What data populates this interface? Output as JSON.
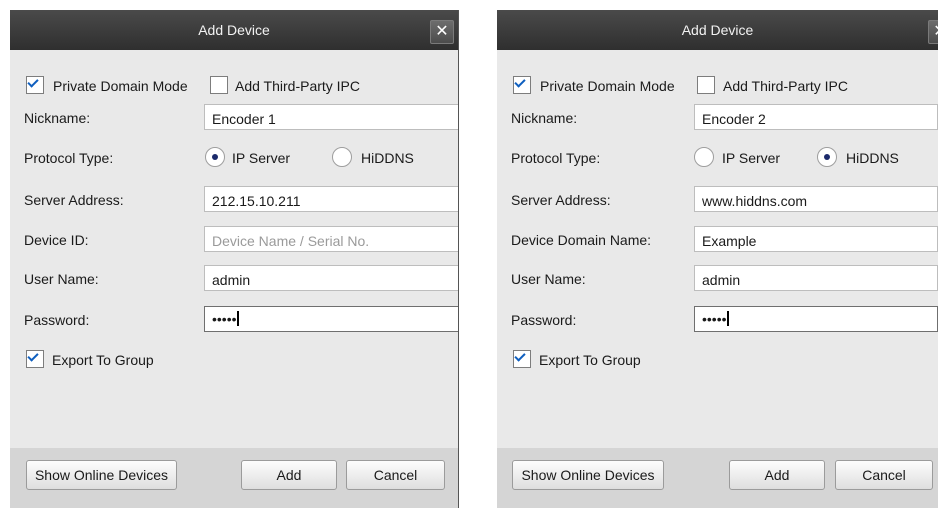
{
  "left_dialog": {
    "title": "Add Device",
    "close_glyph": "✕",
    "private_domain_mode": {
      "label": "Private Domain Mode",
      "checked": true
    },
    "add_third_party_ipc": {
      "label": "Add Third-Party IPC",
      "checked": false
    },
    "nickname": {
      "label": "Nickname:",
      "value": "Encoder 1"
    },
    "protocol_type": {
      "label": "Protocol Type:",
      "options": [
        "IP Server",
        "HiDDNS"
      ],
      "selected": "IP Server"
    },
    "server_address": {
      "label": "Server Address:",
      "value": "212.15.10.211"
    },
    "device_id": {
      "label": "Device ID:",
      "value": "",
      "placeholder": "Device Name / Serial No."
    },
    "user_name": {
      "label": "User Name:",
      "value": "admin"
    },
    "password": {
      "label": "Password:",
      "value": "•••••"
    },
    "export_to_group": {
      "label": "Export To Group",
      "checked": true
    },
    "buttons": {
      "show_online_devices": "Show Online Devices",
      "add": "Add",
      "cancel": "Cancel"
    }
  },
  "right_dialog": {
    "title": "Add Device",
    "close_glyph": "✕",
    "private_domain_mode": {
      "label": "Private Domain Mode",
      "checked": true
    },
    "add_third_party_ipc": {
      "label": "Add Third-Party IPC",
      "checked": false
    },
    "nickname": {
      "label": "Nickname:",
      "value": "Encoder 2"
    },
    "protocol_type": {
      "label": "Protocol Type:",
      "options": [
        "IP Server",
        "HiDDNS"
      ],
      "selected": "HiDDNS"
    },
    "server_address": {
      "label": "Server Address:",
      "value": "www.hiddns.com"
    },
    "device_domain_name": {
      "label": "Device Domain Name:",
      "value": "Example"
    },
    "user_name": {
      "label": "User Name:",
      "value": "admin"
    },
    "password": {
      "label": "Password:",
      "value": "•••••"
    },
    "export_to_group": {
      "label": "Export To Group",
      "checked": true
    },
    "buttons": {
      "show_online_devices": "Show Online Devices",
      "add": "Add",
      "cancel": "Cancel"
    }
  }
}
